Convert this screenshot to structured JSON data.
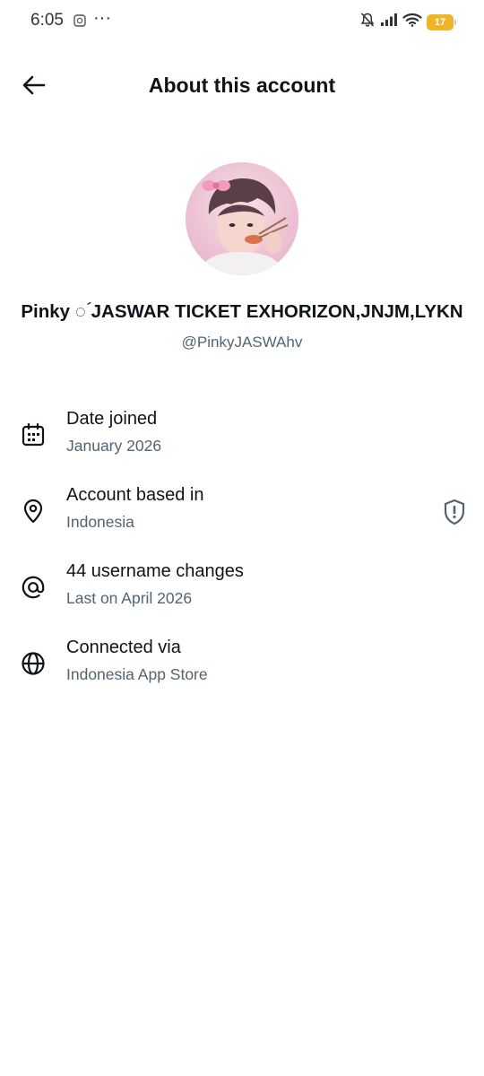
{
  "status_bar": {
    "time": "6:05",
    "dots": "···",
    "battery_level": "17",
    "icons": [
      "app-notification-icon",
      "bell-muted-icon",
      "signal-icon",
      "wifi-icon",
      "battery-icon"
    ],
    "battery_color": "#f0b428"
  },
  "header": {
    "title": "About this account",
    "back_icon": "arrow-left-icon"
  },
  "profile": {
    "display_name": "Pinky ◌ؘ JASWAR TICKET EXHORIZON,JNJM,LYKN",
    "handle": "@PinkyJASWAhv"
  },
  "details": [
    {
      "icon": "calendar-icon",
      "title": "Date joined",
      "subtitle": "January 2026"
    },
    {
      "icon": "location-pin-icon",
      "title": "Account based in",
      "subtitle": "Indonesia",
      "action_icon": "shield-alert-icon"
    },
    {
      "icon": "at-sign-icon",
      "title": "44 username changes",
      "subtitle": "Last on April 2026"
    },
    {
      "icon": "globe-icon",
      "title": "Connected via",
      "subtitle": "Indonesia App Store"
    }
  ],
  "colors": {
    "text_primary": "#0f1419",
    "text_secondary": "#536471",
    "background": "#ffffff"
  }
}
